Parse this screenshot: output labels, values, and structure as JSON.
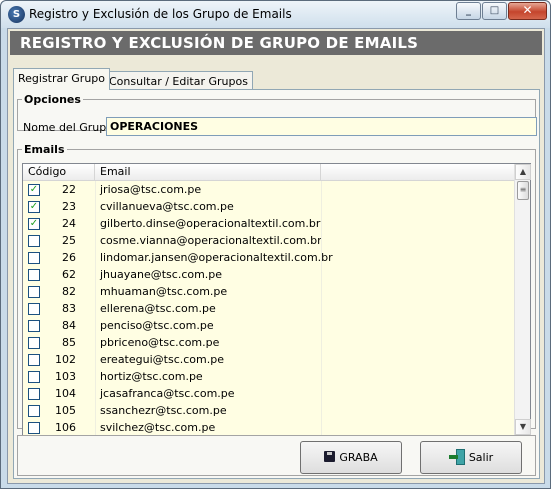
{
  "window": {
    "title": "Registro y Exclusión de los Grupo de Emails",
    "icon": "app-logo-icon",
    "controls": {
      "minimize": "minimize-icon",
      "maximize": "maximize-icon",
      "close": "close-icon"
    }
  },
  "header": {
    "title": "REGISTRO Y EXCLUSIÓN DE GRUPO DE EMAILS"
  },
  "tabs": [
    {
      "label": "Registrar Grupo",
      "active": true
    },
    {
      "label": "Consultar / Editar Grupos",
      "active": false
    }
  ],
  "opciones": {
    "legend": "Opciones",
    "group_name_label": "Nome del Grupo:",
    "group_name_value": "OPERACIONES"
  },
  "emails": {
    "legend": "Emails",
    "columns": [
      "Código",
      "Email"
    ],
    "rows": [
      {
        "checked": true,
        "code": "22",
        "email": "jriosa@tsc.com.pe"
      },
      {
        "checked": true,
        "code": "23",
        "email": "cvillanueva@tsc.com.pe"
      },
      {
        "checked": true,
        "code": "24",
        "email": "gilberto.dinse@operacionaltextil.com.br"
      },
      {
        "checked": false,
        "code": "25",
        "email": "cosme.vianna@operacionaltextil.com.br"
      },
      {
        "checked": false,
        "code": "26",
        "email": "lindomar.jansen@operacionaltextil.com.br"
      },
      {
        "checked": false,
        "code": "62",
        "email": "jhuayane@tsc.com.pe"
      },
      {
        "checked": false,
        "code": "82",
        "email": "mhuaman@tsc.com.pe"
      },
      {
        "checked": false,
        "code": "83",
        "email": "ellerena@tsc.com.pe"
      },
      {
        "checked": false,
        "code": "84",
        "email": "penciso@tsc.com.pe"
      },
      {
        "checked": false,
        "code": "85",
        "email": "pbriceno@tsc.com.pe"
      },
      {
        "checked": false,
        "code": "102",
        "email": "ereategui@tsc.com.pe"
      },
      {
        "checked": false,
        "code": "103",
        "email": "hortiz@tsc.com.pe"
      },
      {
        "checked": false,
        "code": "104",
        "email": "jcasafranca@tsc.com.pe"
      },
      {
        "checked": false,
        "code": "105",
        "email": "ssanchezr@tsc.com.pe"
      },
      {
        "checked": false,
        "code": "106",
        "email": "svilchez@tsc.com.pe"
      }
    ]
  },
  "buttons": {
    "graba": {
      "label": "GRABA",
      "icon": "floppy-disk-icon"
    },
    "salir": {
      "label": "Salir",
      "icon": "exit-door-icon"
    }
  }
}
